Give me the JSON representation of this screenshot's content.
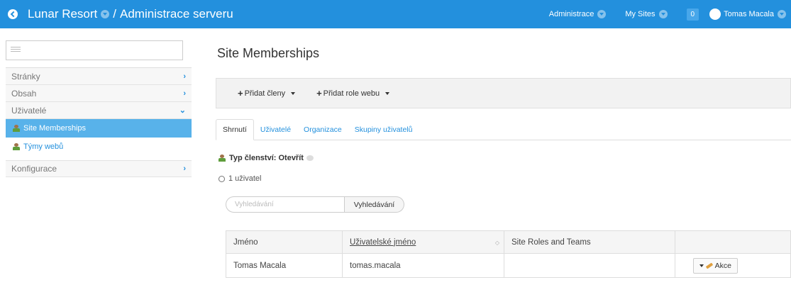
{
  "header": {
    "site_name": "Lunar Resort",
    "separator": "/",
    "section": "Administrace serveru",
    "nav_admin": "Administrace",
    "nav_sites": "My Sites",
    "notifications": "0",
    "user": "Tomas Macala"
  },
  "sidebar": {
    "items": [
      {
        "label": "Stránky"
      },
      {
        "label": "Obsah"
      },
      {
        "label": "Uživatelé"
      }
    ],
    "sub_items": [
      {
        "label": "Site Memberships"
      },
      {
        "label": "Týmy webů"
      }
    ],
    "config_label": "Konfigurace"
  },
  "main": {
    "title": "Site Memberships",
    "toolbar": {
      "add_members": "Přidat členy",
      "add_roles": "Přidat role webu"
    },
    "tabs": [
      {
        "label": "Shrnutí"
      },
      {
        "label": "Uživatelé"
      },
      {
        "label": "Organizace"
      },
      {
        "label": "Skupiny uživatelů"
      }
    ],
    "membership_type": "Typ členství: Otevřít",
    "user_count": "1 uživatel",
    "search": {
      "placeholder": "Vyhledávání",
      "button": "Vyhledávání"
    },
    "table": {
      "columns": [
        "Jméno",
        "Uživatelské jméno",
        "Site Roles and Teams",
        ""
      ],
      "rows": [
        {
          "name": "Tomas Macala",
          "username": "tomas.macala",
          "roles": "",
          "action": "Akce"
        }
      ]
    }
  },
  "colors": {
    "accent": "#2390dd",
    "active_menu": "#58b2ea"
  }
}
